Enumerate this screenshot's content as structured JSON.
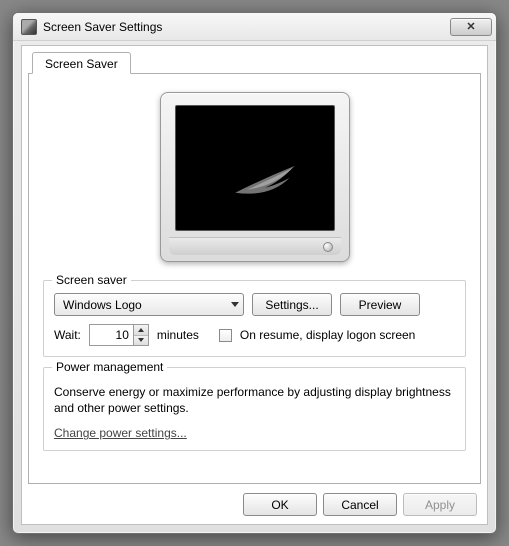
{
  "window": {
    "title": "Screen Saver Settings"
  },
  "tab": {
    "label": "Screen Saver"
  },
  "screensaver_group": {
    "title": "Screen saver",
    "selected": "Windows Logo",
    "settings_btn": "Settings...",
    "preview_btn": "Preview",
    "wait_label": "Wait:",
    "wait_value": "10",
    "wait_unit": "minutes",
    "resume_label": "On resume, display logon screen"
  },
  "power_group": {
    "title": "Power management",
    "description": "Conserve energy or maximize performance by adjusting display brightness and other power settings.",
    "link": "Change power settings..."
  },
  "buttons": {
    "ok": "OK",
    "cancel": "Cancel",
    "apply": "Apply"
  }
}
